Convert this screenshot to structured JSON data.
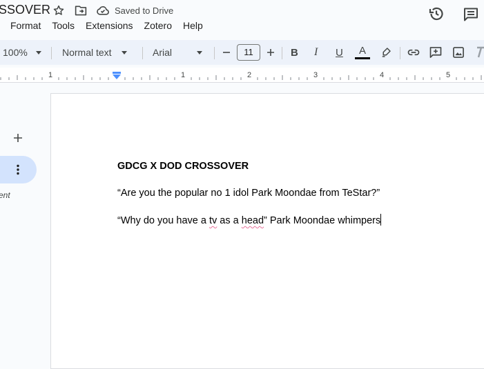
{
  "title_bar": {
    "doc_title": "SSOVER",
    "saved_status": "Saved to Drive",
    "icons": [
      "star-icon",
      "move-to-folder-icon",
      "cloud-done-icon",
      "version-history-icon",
      "comments-icon"
    ]
  },
  "menubar": {
    "items": [
      "Format",
      "Tools",
      "Extensions",
      "Zotero",
      "Help"
    ]
  },
  "toolbar": {
    "zoom": "100%",
    "paragraph_style": "Normal text",
    "font_family": "Arial",
    "font_size": "11",
    "bold_label": "B",
    "italic_label": "I",
    "underline_label": "U",
    "text_color_label": "A",
    "text_color": "#000000",
    "accent": "#0b57d0"
  },
  "ruler": {
    "labels": [
      "1",
      "1",
      "2",
      "3",
      "4",
      "5"
    ]
  },
  "sidebar": {
    "tab_label": "ent"
  },
  "document": {
    "heading": "GDCG X DOD CROSSOVER",
    "paragraph1": "“Are you the popular no 1 idol Park Moondae from TeStar?”",
    "p2_part1": "“Why do you have a ",
    "p2_misspelled1": "tv",
    "p2_part2": " as a ",
    "p2_misspelled2": "head",
    "p2_part3": "” Park Moondae whimpers"
  }
}
